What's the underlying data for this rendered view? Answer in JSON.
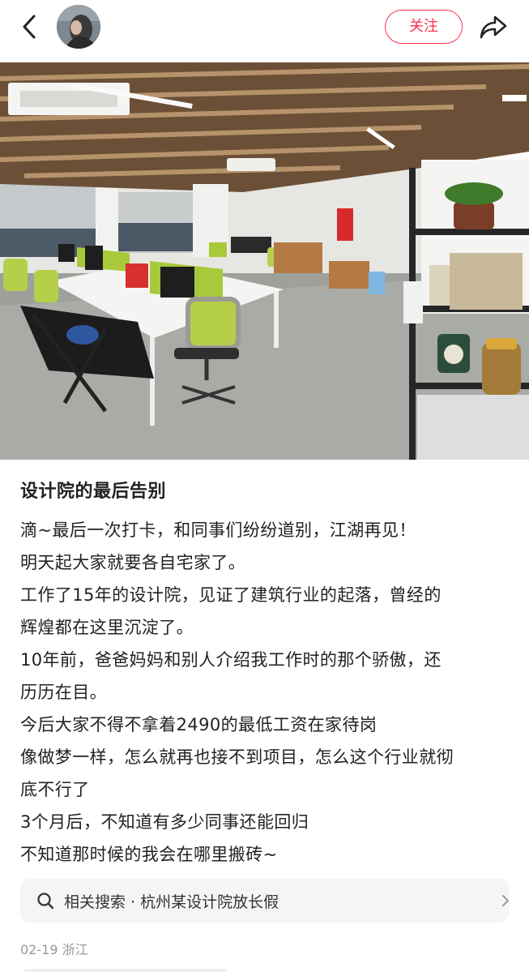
{
  "header": {
    "back_icon": "chevron-left-icon",
    "avatar_icon": "avatar",
    "follow_label": "关注",
    "share_icon": "share-arrow-icon",
    "accent_color": "#ff2e4d"
  },
  "post": {
    "photo_description_icon": "office-photo",
    "title": "设计院的最后告别",
    "lines": [
      "滴~最后一次打卡，和同事们纷纷道别，江湖再见！",
      "明天起大家就要各自宅家了。",
      "工作了15年的设计院，见证了建筑行业的起落，曾经的",
      "辉煌都在这里沉淀了。",
      "10年前，爸爸妈妈和别人介绍我工作时的那个骄傲，还",
      "历历在目。",
      "今后大家不得不拿着2490的最低工资在家待岗",
      "像做梦一样，怎么就再也接不到项目，怎么这个行业就彻",
      "底不行了",
      "3个月后，不知道有多少同事还能回归",
      "不知道那时候的我会在哪里搬砖~"
    ]
  },
  "related_search": {
    "icon": "search-icon",
    "text": "相关搜索 · 杭州某设计院放长假",
    "chevron_icon": "chevron-right-icon"
  },
  "meta": {
    "date_location": "02-19 浙江"
  }
}
